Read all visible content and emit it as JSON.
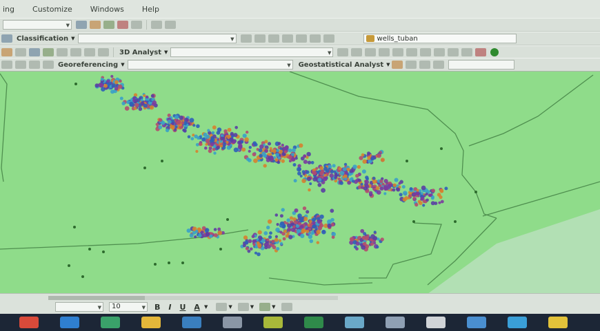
{
  "menubar": {
    "items": [
      "ing",
      "Customize",
      "Windows",
      "Help"
    ]
  },
  "toolbar_classification": {
    "label": "Classification"
  },
  "toolbar_3d": {
    "label": "3D Analyst"
  },
  "toolbar_geostat": {
    "label": "Geostatistical Analyst"
  },
  "toolbar_georef": {
    "label": "Georeferencing"
  },
  "layer_select": {
    "value": "wells_tuban"
  },
  "draw_toolbar": {
    "font_size": "10",
    "bold": "B",
    "italic": "I",
    "underline": "U",
    "font_color": "A"
  },
  "colors": {
    "map_background": "#8fdc8a",
    "boundary": "#4f8f4f",
    "sea": "#d4e4dc",
    "well_colors": [
      "#7b3b9e",
      "#5a3fa2",
      "#d6812f",
      "#3aa0c8",
      "#2f5fb8",
      "#b24d6e"
    ],
    "sparse_well": "#2d6b2d"
  },
  "taskbar": {
    "icons": [
      "chrome-icon",
      "edge-icon",
      "arcmap-icon",
      "folder-icon",
      "app-icon",
      "app-icon",
      "app-icon",
      "excel-icon",
      "app-icon",
      "app-icon",
      "app-icon",
      "app-icon",
      "app-icon",
      "app-icon"
    ],
    "icon_colors": [
      "#d94a3a",
      "#2f7fd0",
      "#3aa16a",
      "#e4b73a",
      "#3a7fbf",
      "#8a96a6",
      "#a8b83a",
      "#2f8a4a",
      "#6aa8c8",
      "#8fa0b4",
      "#d0d4d8",
      "#4a8fd0",
      "#3a9fd8",
      "#e2c23a"
    ]
  }
}
